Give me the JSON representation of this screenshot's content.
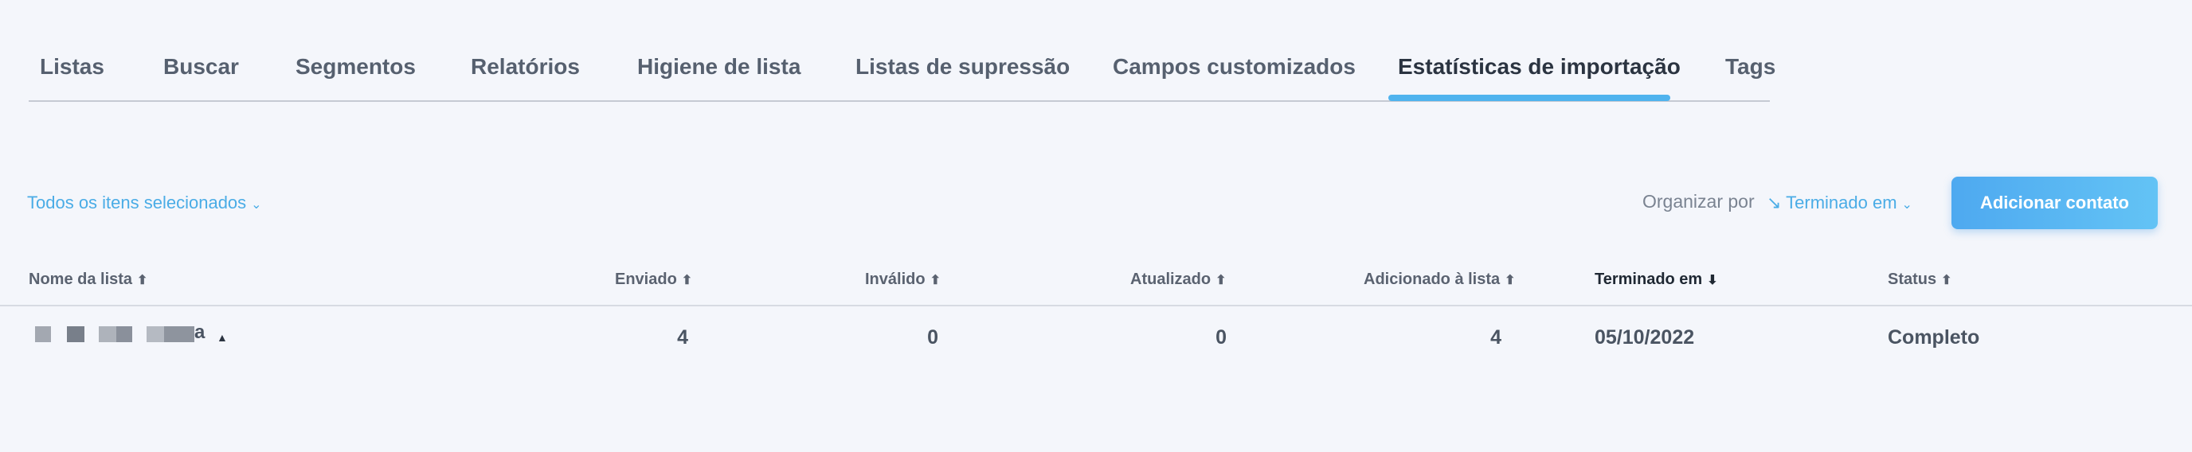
{
  "tabs": [
    {
      "label": "Listas"
    },
    {
      "label": "Buscar"
    },
    {
      "label": "Segmentos"
    },
    {
      "label": "Relatórios"
    },
    {
      "label": "Higiene de lista"
    },
    {
      "label": "Listas de supressão"
    },
    {
      "label": "Campos customizados"
    },
    {
      "label": "Estatísticas de importação"
    },
    {
      "label": "Tags"
    }
  ],
  "active_tab": "Estatísticas de importação",
  "toolbar": {
    "filter_label": "Todos os itens selecionados",
    "sort_label": "Organizar por",
    "sort_value": "↘ Terminado em",
    "add_button": "Adicionar contato"
  },
  "table": {
    "columns": [
      {
        "label": "Nome da lista",
        "arrow": "⬆"
      },
      {
        "label": "Enviado",
        "arrow": "⬆"
      },
      {
        "label": "Inválido",
        "arrow": "⬆"
      },
      {
        "label": "Atualizado",
        "arrow": "⬆"
      },
      {
        "label": "Adicionado à lista",
        "arrow": "⬆"
      },
      {
        "label": "Terminado em",
        "arrow": "⬇"
      },
      {
        "label": "Status",
        "arrow": "⬆"
      }
    ],
    "rows": [
      {
        "name_suffix": "a",
        "sent": "4",
        "invalid": "0",
        "updated": "0",
        "added": "4",
        "finished": "05/10/2022",
        "status": "Completo"
      }
    ]
  },
  "icons": {
    "dropdown": "chevron-down-icon",
    "sort_asc": "arrow-up-icon",
    "sort_desc": "arrow-down-icon",
    "expand": "caret-up-icon"
  },
  "colors": {
    "accent": "#4aace6",
    "tab_underline": "#4fb3ee",
    "button": "#56b4f2"
  }
}
